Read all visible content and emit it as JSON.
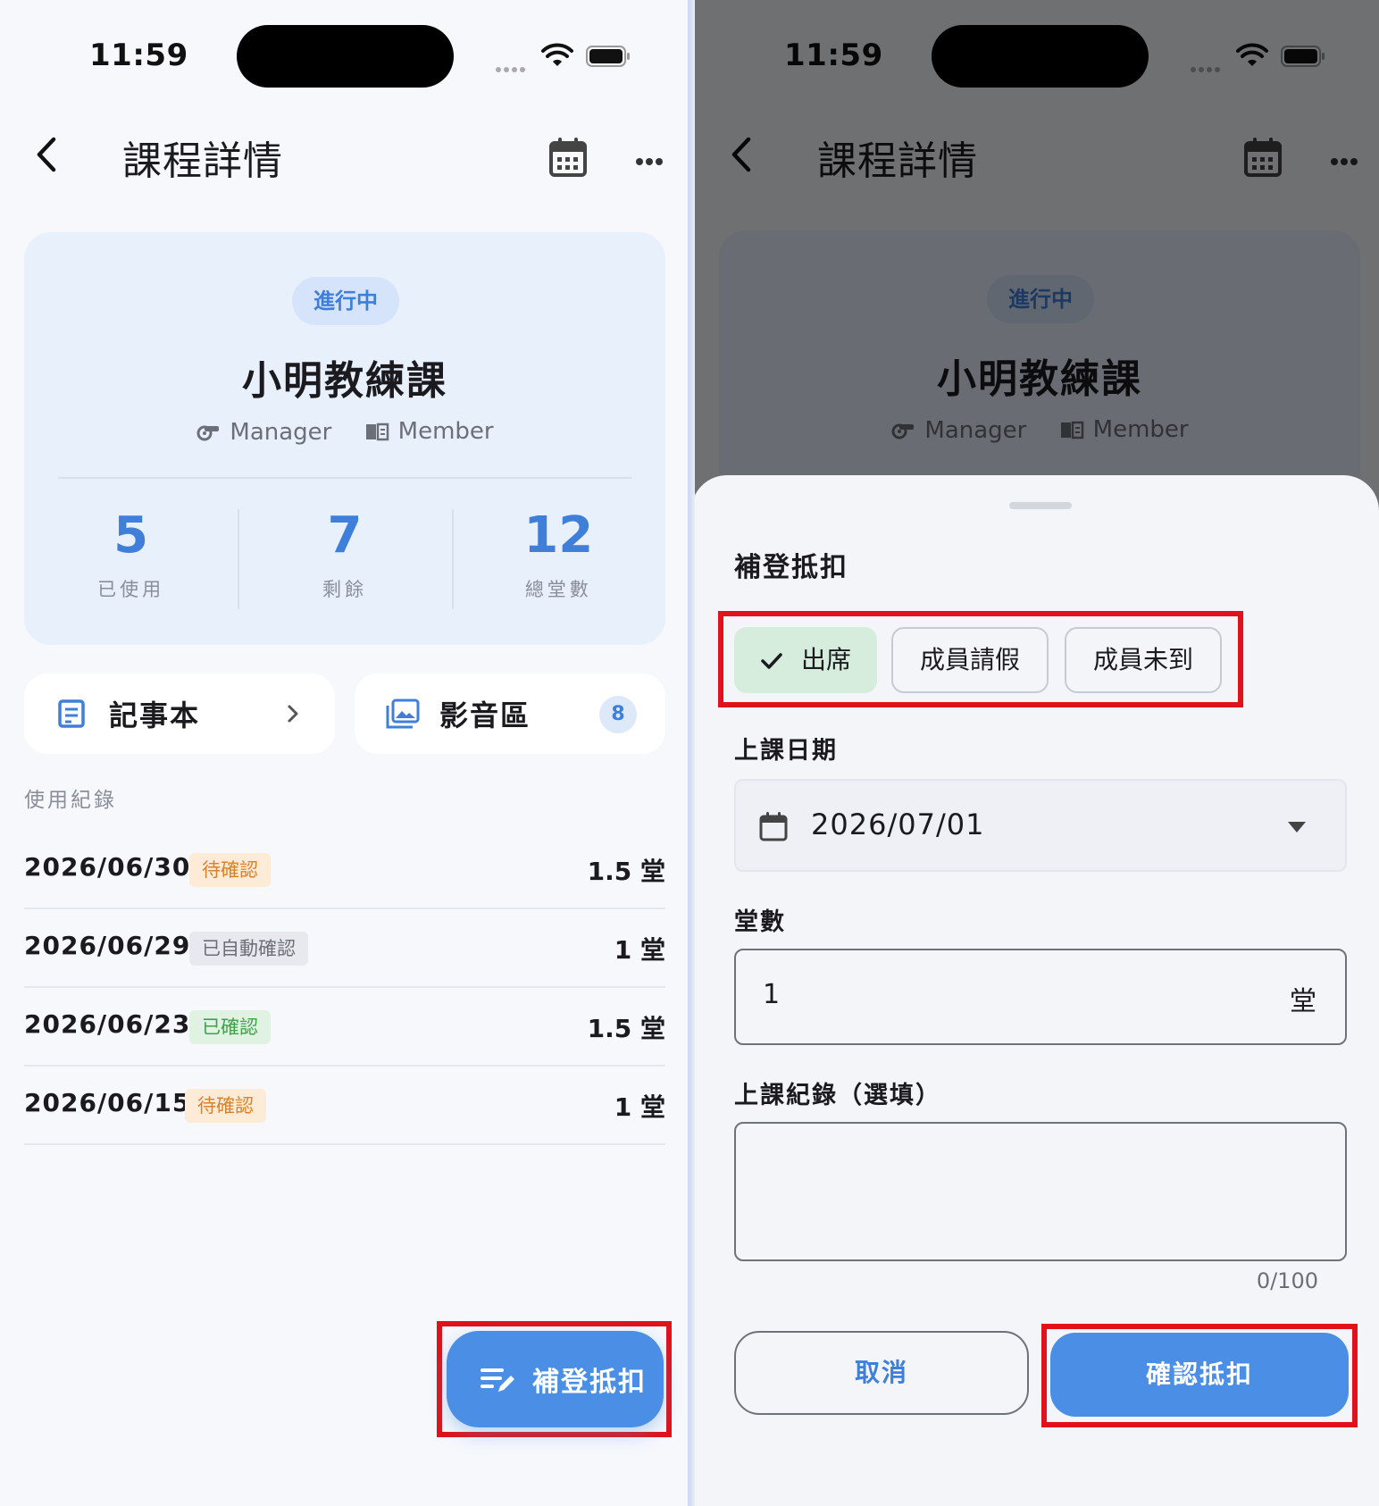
{
  "status_bar": {
    "time": "11:59"
  },
  "header": {
    "title": "課程詳情",
    "back_icon": "chevron-left-icon",
    "calendar_icon": "calendar-icon",
    "more_icon": "more-horizontal-icon"
  },
  "course": {
    "status": "進行中",
    "name": "小明教練課",
    "roles": [
      "Manager",
      "Member"
    ],
    "stats": [
      {
        "value": "5",
        "label": "已使用"
      },
      {
        "value": "7",
        "label": "剩餘"
      },
      {
        "value": "12",
        "label": "總堂數"
      }
    ]
  },
  "quick_links": {
    "notebook": {
      "label": "記事本"
    },
    "media": {
      "label": "影音區",
      "badge": "8"
    }
  },
  "usage": {
    "title": "使用紀錄",
    "records": [
      {
        "date": "2026/06/30",
        "tag": "待確認",
        "tag_type": "pending",
        "amount": "1.5 堂"
      },
      {
        "date": "2026/06/29",
        "tag": "已自動確認",
        "tag_type": "auto",
        "amount": "1 堂"
      },
      {
        "date": "2026/06/23",
        "tag": "已確認",
        "tag_type": "ok",
        "amount": "1.5 堂"
      },
      {
        "date": "2026/06/15",
        "tag": "待確認",
        "tag_type": "pending",
        "amount": "1 堂"
      }
    ]
  },
  "fab": {
    "label": "補登抵扣"
  },
  "sheet": {
    "title": "補登抵扣",
    "segments": [
      "出席",
      "成員請假",
      "成員未到"
    ],
    "selected_segment": "出席",
    "date_label": "上課日期",
    "date_value": "2026/07/01",
    "count_label": "堂數",
    "count_value": "1",
    "count_unit": "堂",
    "note_label": "上課紀錄（選填）",
    "note_value": "",
    "note_counter": "0/100",
    "cancel_label": "取消",
    "confirm_label": "確認抵扣"
  },
  "colors": {
    "accent": "#4a8ee6",
    "highlight": "#e0121b",
    "pending": "#d9822b",
    "ok": "#3da24a",
    "selected_segment": "#d6ecdd"
  }
}
